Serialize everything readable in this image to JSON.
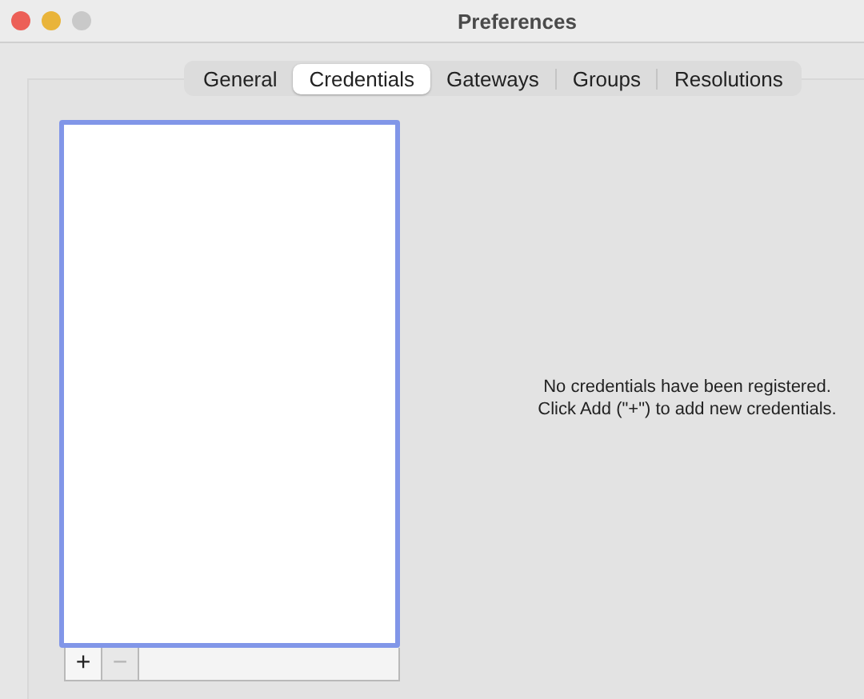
{
  "window": {
    "title": "Preferences"
  },
  "tabs": [
    {
      "label": "General",
      "selected": false
    },
    {
      "label": "Credentials",
      "selected": true
    },
    {
      "label": "Gateways",
      "selected": false
    },
    {
      "label": "Groups",
      "selected": false
    },
    {
      "label": "Resolutions",
      "selected": false
    }
  ],
  "list_buttons": [
    {
      "label": "+",
      "disabled": false
    },
    {
      "label": "−",
      "disabled": true
    }
  ],
  "empty_message": [
    "No credentials have been registered.",
    "Click Add (\"+\") to add new credentials."
  ]
}
